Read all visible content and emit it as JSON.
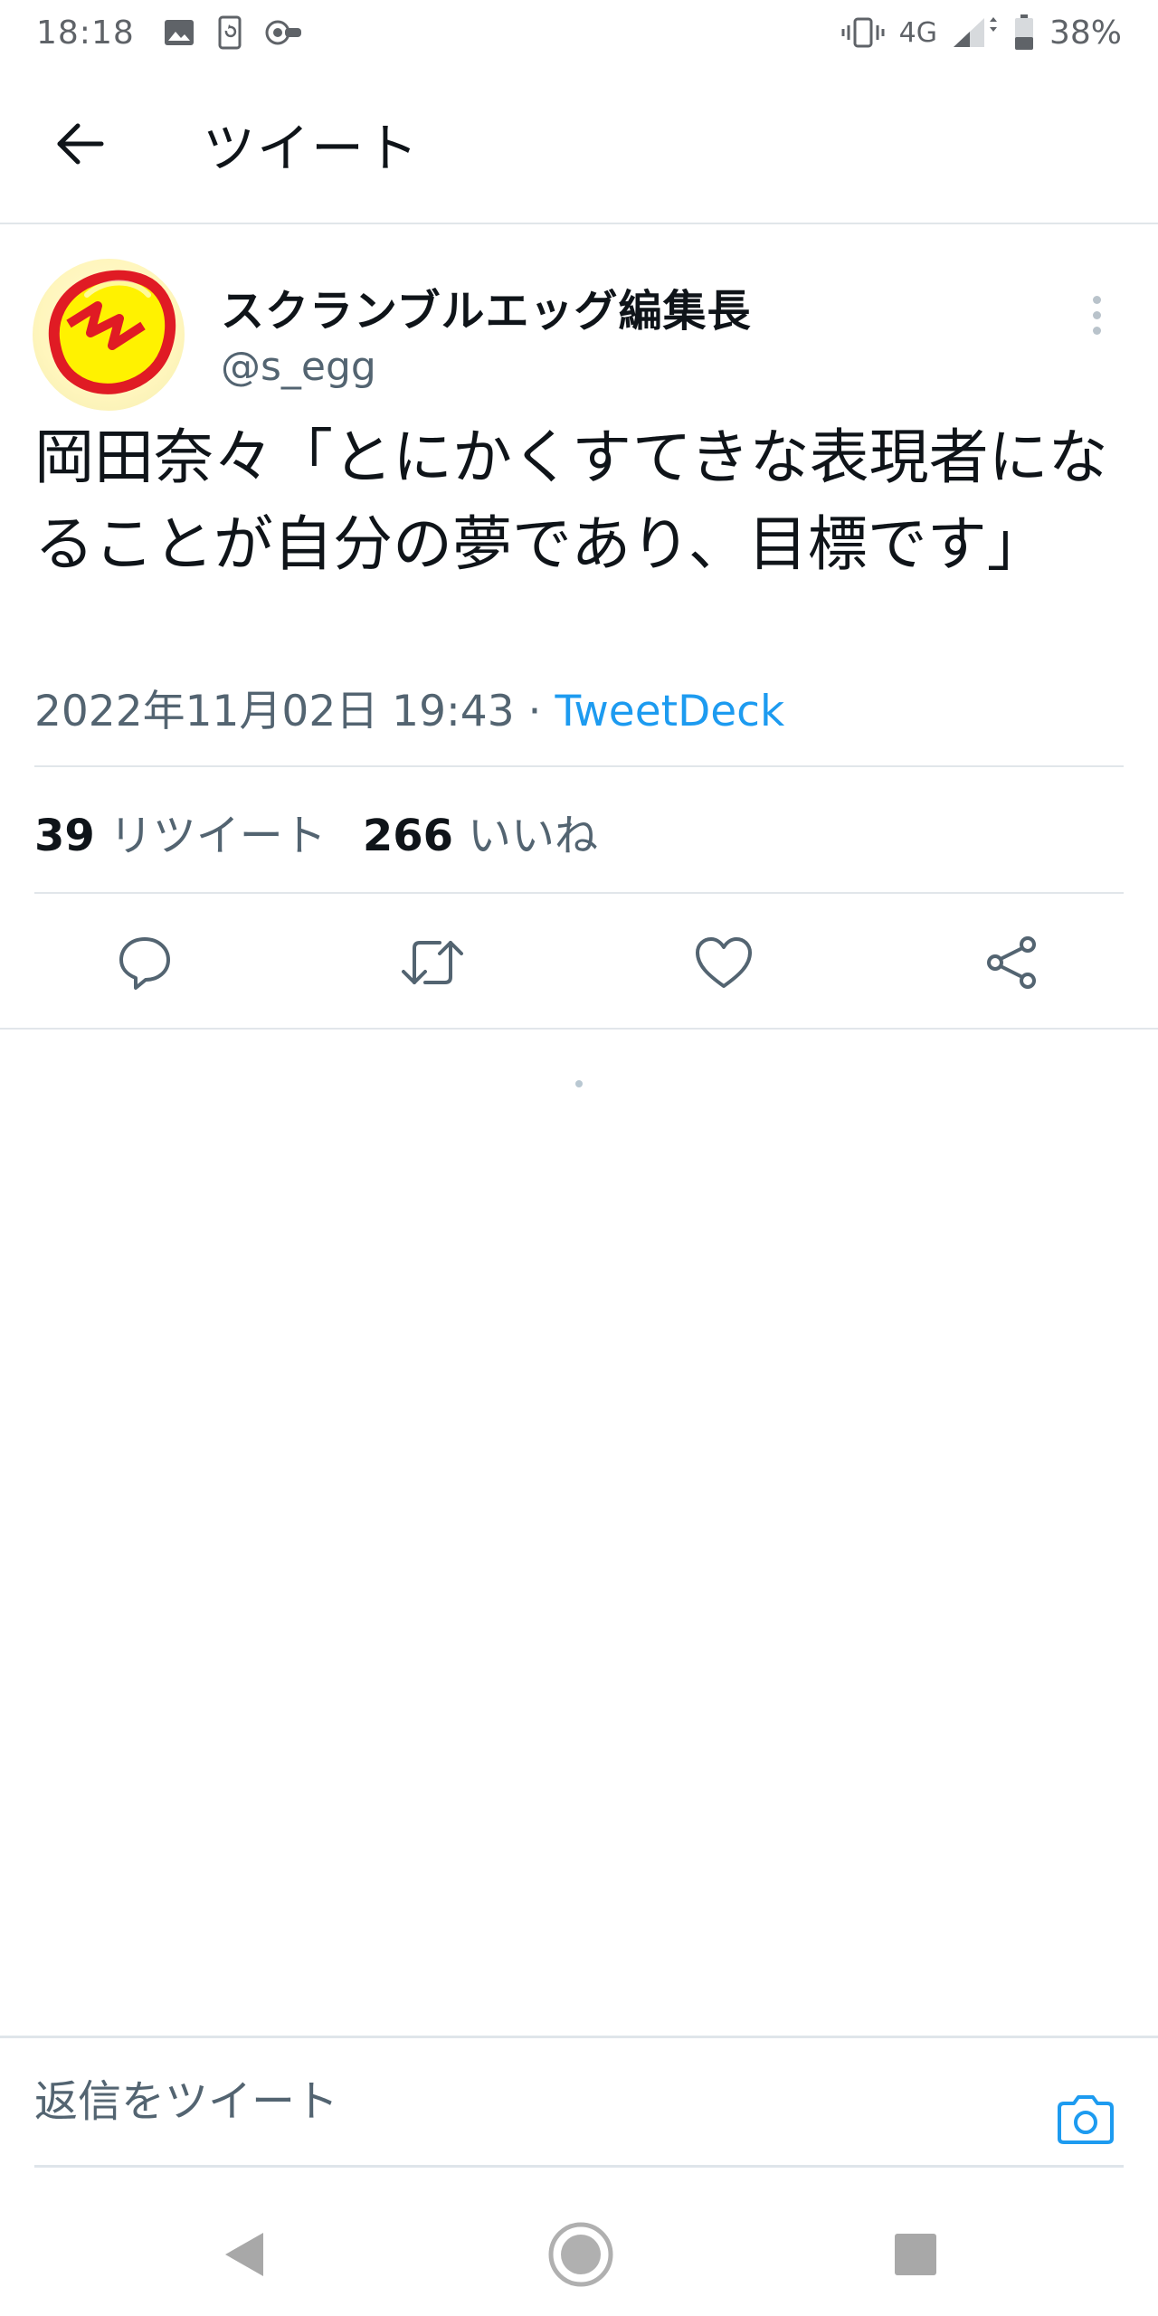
{
  "status_bar": {
    "time": "18:18",
    "network": "4G",
    "battery": "38%",
    "icons": [
      "image-icon",
      "rotate-icon",
      "record-icon",
      "vibrate-icon",
      "signal-icon",
      "battery-icon"
    ]
  },
  "nav": {
    "title": "ツイート",
    "back_icon": "arrow-left-icon"
  },
  "tweet": {
    "author_name": "スクランブルエッグ編集長",
    "author_handle": "@s_egg",
    "text": "岡田奈々「とにかくすてきな表現者になることが自分の夢であり、目標です」",
    "datetime": "2022年11月02日 19:43",
    "separator": " · ",
    "source": "TweetDeck",
    "retweet_count": "39",
    "retweet_label": "リツイート",
    "like_count": "266",
    "like_label": "いいね",
    "actions": [
      "reply-icon",
      "retweet-icon",
      "like-icon",
      "share-icon"
    ]
  },
  "reply": {
    "placeholder": "返信をツイート",
    "camera_icon": "camera-icon"
  },
  "colors": {
    "accent": "#1d9bf0",
    "text_primary": "#0f1419",
    "text_secondary": "#536471",
    "divider": "#e1e6ea"
  }
}
